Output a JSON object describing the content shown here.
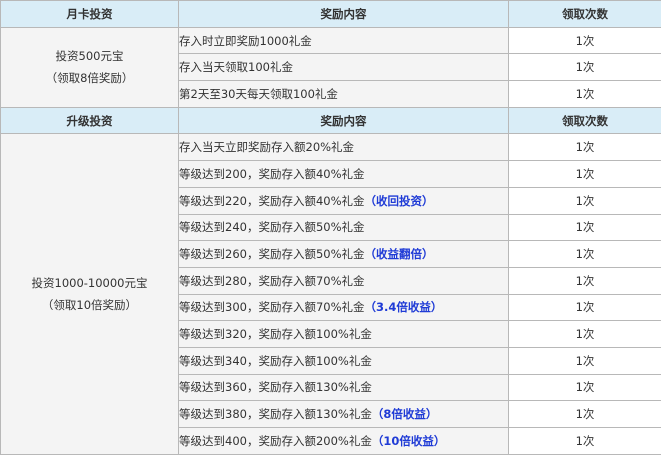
{
  "section1": {
    "header": {
      "col1": "月卡投资",
      "col2": "奖励内容",
      "col3": "领取次数"
    },
    "label": {
      "line1": "投资500元宝",
      "line2": "（领取8倍奖励）"
    },
    "rows": [
      {
        "text": "存入时立即奖励1000礼金",
        "highlight": "",
        "count": "1次"
      },
      {
        "text": "存入当天领取100礼金",
        "highlight": "",
        "count": "1次"
      },
      {
        "text": "第2天至30天每天领取100礼金",
        "highlight": "",
        "count": "1次"
      }
    ]
  },
  "section2": {
    "header": {
      "col1": "升级投资",
      "col2": "奖励内容",
      "col3": "领取次数"
    },
    "label": {
      "line1": "投资1000-10000元宝",
      "line2": "（领取10倍奖励）"
    },
    "rows": [
      {
        "text": "存入当天立即奖励存入额20%礼金",
        "highlight": "",
        "count": "1次"
      },
      {
        "text": "等级达到200，奖励存入额40%礼金",
        "highlight": "",
        "count": "1次"
      },
      {
        "text": "等级达到220，奖励存入额40%礼金",
        "highlight": "（收回投资）",
        "count": "1次"
      },
      {
        "text": "等级达到240，奖励存入额50%礼金",
        "highlight": "",
        "count": "1次"
      },
      {
        "text": "等级达到260，奖励存入额50%礼金",
        "highlight": "（收益翻倍）",
        "count": "1次"
      },
      {
        "text": "等级达到280，奖励存入额70%礼金",
        "highlight": "",
        "count": "1次"
      },
      {
        "text": "等级达到300，奖励存入额70%礼金",
        "highlight": "（3.4倍收益）",
        "count": "1次"
      },
      {
        "text": "等级达到320，奖励存入额100%礼金",
        "highlight": "",
        "count": "1次"
      },
      {
        "text": "等级达到340，奖励存入额100%礼金",
        "highlight": "",
        "count": "1次"
      },
      {
        "text": "等级达到360，奖励存入额130%礼金",
        "highlight": "",
        "count": "1次"
      },
      {
        "text": "等级达到380，奖励存入额130%礼金",
        "highlight": "（8倍收益）",
        "count": "1次"
      },
      {
        "text": "等级达到400，奖励存入额200%礼金",
        "highlight": "（10倍收益）",
        "count": "1次"
      }
    ]
  },
  "colors": {
    "header_bg": "#d9edf7",
    "cell_bg": "#f4f4f4",
    "highlight": "#1f3bd6",
    "border": "#b8b8b8"
  }
}
